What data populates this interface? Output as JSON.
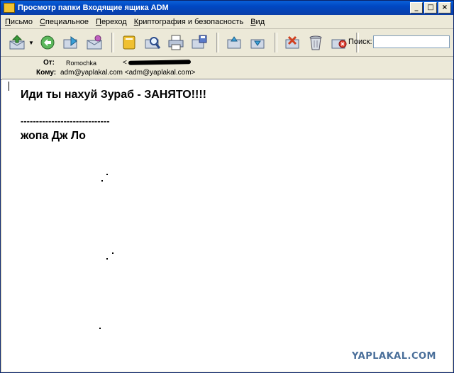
{
  "window": {
    "title": "Просмотр папки Входящие ящика ADM",
    "buttons": {
      "minimize": "_",
      "maximize": "□",
      "close": "×"
    }
  },
  "menu": [
    "Письмо",
    "Специальное",
    "Переход",
    "Криптография и безопасность",
    "Вид"
  ],
  "toolbar": {
    "search_label": "Поиск:",
    "search_value": "",
    "icons": [
      "get-mail-icon",
      "reply-icon",
      "forward-icon",
      "send-icon",
      "address-book-icon",
      "find-icon",
      "print-icon",
      "save-icon",
      "prev-message-icon",
      "next-message-icon",
      "junk-icon",
      "trash-icon",
      "delete-icon"
    ]
  },
  "headers": {
    "from_label": "От:",
    "from_name": "Romochka",
    "from_addr_open": "<",
    "to_label": "Кому:",
    "to_value": "adm@yaplakal.com <adm@yaplakal.com>"
  },
  "message": {
    "line1": "Иди ты нахуй Зураб - ЗАНЯТО!!!!",
    "line2": "-----------------------------",
    "line3": "жопа Дж Ло"
  },
  "watermark": "YAPLAKAL.COM",
  "colors": {
    "titlebar": "#0a5fd8",
    "accent_green": "#3a9a3a",
    "accent_orange": "#e08a1e"
  }
}
